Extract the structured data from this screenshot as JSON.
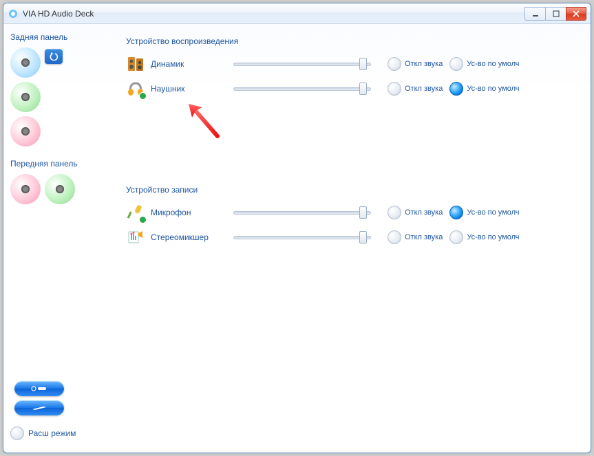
{
  "window": {
    "title": "VIA HD Audio Deck"
  },
  "sidebar": {
    "rear_label": "Задняя панель",
    "front_label": "Передняя панель",
    "ext_mode_label": "Расш режим",
    "rear_ports": [
      {
        "color": "#bfe6ff"
      },
      {
        "color": "#c0f2c0"
      },
      {
        "color": "#ffc9d9"
      }
    ],
    "front_ports": [
      {
        "color": "#ffc9d9"
      },
      {
        "color": "#c0f2c0"
      }
    ]
  },
  "playback": {
    "title": "Устройство воспроизведения",
    "devices": [
      {
        "name": "Динамик",
        "slider": 0.92,
        "mute": false,
        "default": false
      },
      {
        "name": "Наушник",
        "slider": 0.92,
        "mute": false,
        "default": true
      }
    ]
  },
  "recording": {
    "title": "Устройство записи",
    "devices": [
      {
        "name": "Микрофон",
        "slider": 0.92,
        "mute": false,
        "default": true
      },
      {
        "name": "Стереомикшер",
        "slider": 0.92,
        "mute": false,
        "default": false
      }
    ]
  },
  "labels": {
    "mute": "Откл звука",
    "default": "Ус-во по умолч"
  }
}
